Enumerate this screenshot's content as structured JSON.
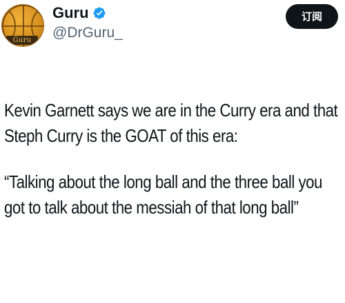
{
  "author": {
    "display_name": "Guru",
    "handle": "@DrGuru_",
    "avatar_text": "Guru",
    "verified": true,
    "verified_icon": "verified-badge-icon",
    "avatar_icon": "basketball-icon"
  },
  "subscribe_button": {
    "label": "订阅"
  },
  "tweet": {
    "paragraphs": [
      "Kevin Garnett says we are in the Curry era and that Steph Curry is the GOAT of this era:",
      "“Talking about the long ball and the three ball you got to talk about the messiah of that long ball”"
    ]
  },
  "colors": {
    "text": "#0f1419",
    "secondary_text": "#536471",
    "verified_blue": "#1d9bf0",
    "button_bg": "#0f1419",
    "button_text": "#ffffff",
    "avatar_orange": "#d8921f"
  }
}
